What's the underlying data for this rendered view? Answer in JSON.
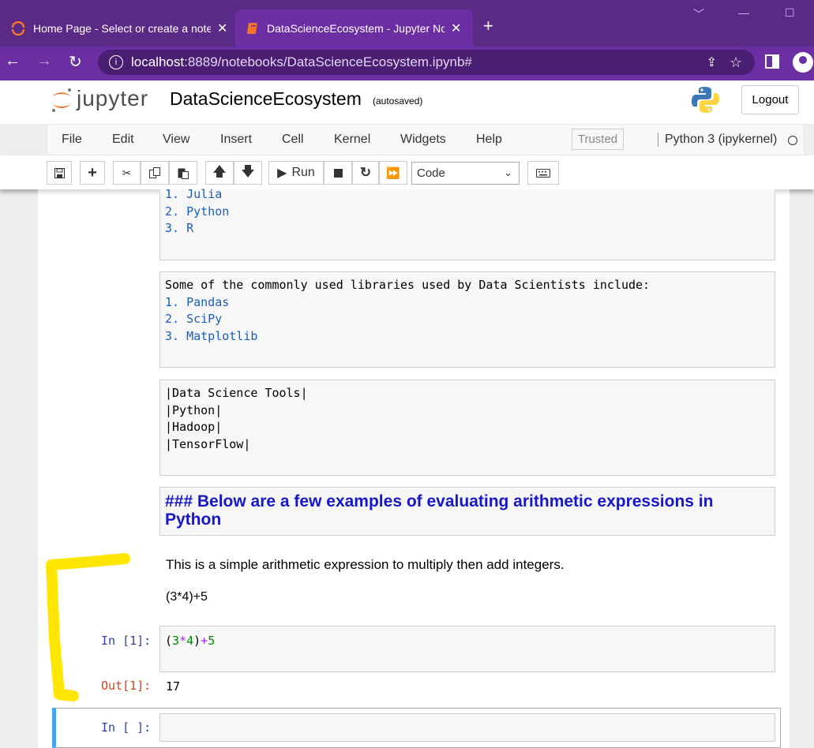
{
  "browser": {
    "tabs": [
      {
        "title": "Home Page - Select or create a notebook",
        "close": "✕"
      },
      {
        "title": "DataScienceEcosystem - Jupyter Notebook",
        "close": "✕"
      }
    ],
    "new_tab": "+",
    "url_host": "localhost",
    "url_rest": ":8889/notebooks/DataScienceEcosystem.ipynb#"
  },
  "header": {
    "logo_text": "jupyter",
    "notebook_name": "DataScienceEcosystem",
    "autosave": "(autosaved)",
    "logout": "Logout"
  },
  "menubar": {
    "items": [
      "File",
      "Edit",
      "View",
      "Insert",
      "Cell",
      "Kernel",
      "Widgets",
      "Help"
    ],
    "trusted": "Trusted",
    "kernel": "Python 3 (ipykernel)"
  },
  "toolbar": {
    "run_label": "Run",
    "cell_type": "Code"
  },
  "cells": {
    "languages": [
      "1. Julia",
      "2. Python",
      "3. R"
    ],
    "libraries_intro": "Some of the commonly used libraries used by Data Scientists include:",
    "libraries": [
      "1. Pandas",
      "2. SciPy",
      "3. Matplotlib"
    ],
    "tools": [
      "|Data Science Tools|",
      "|Python|",
      "|Hadoop|",
      "|TensorFlow|"
    ],
    "heading": "### Below are a few examples of evaluating arithmetic expressions in Python",
    "rendered_text": "This is a simple arithmetic expression to multiply then add integers.",
    "rendered_expr": "(3*4)+5",
    "in1_prompt": "In [1]:",
    "in1_code": {
      "p1": "(",
      "n1": "3",
      "op1": "*",
      "n2": "4",
      "p2": ")",
      "op2": "+",
      "n3": "5"
    },
    "out1_prompt": "Out[1]:",
    "out1_value": "17",
    "empty_prompt": "In [ ]:"
  },
  "colors": {
    "titlebar": "#5b2a86",
    "navbar": "#6b2fa3",
    "highlight": "#ffe600"
  }
}
